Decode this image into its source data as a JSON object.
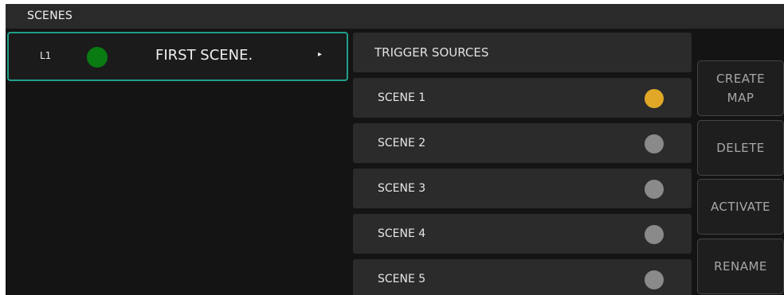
{
  "header": {
    "title": "SCENES"
  },
  "scenes": [
    {
      "layer": "L1",
      "status_color": "#0a7a12",
      "name": "FIRST SCENE.",
      "arrow": "▸"
    }
  ],
  "triggers": {
    "header": "TRIGGER SOURCES",
    "items": [
      {
        "label": "SCENE 1",
        "status": "active",
        "status_color": "#e0a826"
      },
      {
        "label": "SCENE 2",
        "status": "inactive",
        "status_color": "#8a8a8a"
      },
      {
        "label": "SCENE 3",
        "status": "inactive",
        "status_color": "#8a8a8a"
      },
      {
        "label": "SCENE 4",
        "status": "inactive",
        "status_color": "#8a8a8a"
      },
      {
        "label": "SCENE 5",
        "status": "inactive",
        "status_color": "#8a8a8a"
      }
    ]
  },
  "actions": {
    "create_map_line1": "CREATE",
    "create_map_line2": "MAP",
    "delete": "DELETE",
    "activate": "ACTIVATE",
    "rename": "RENAME"
  },
  "colors": {
    "accent": "#1fa08a",
    "background": "#141414",
    "panel": "#2b2b2b"
  }
}
